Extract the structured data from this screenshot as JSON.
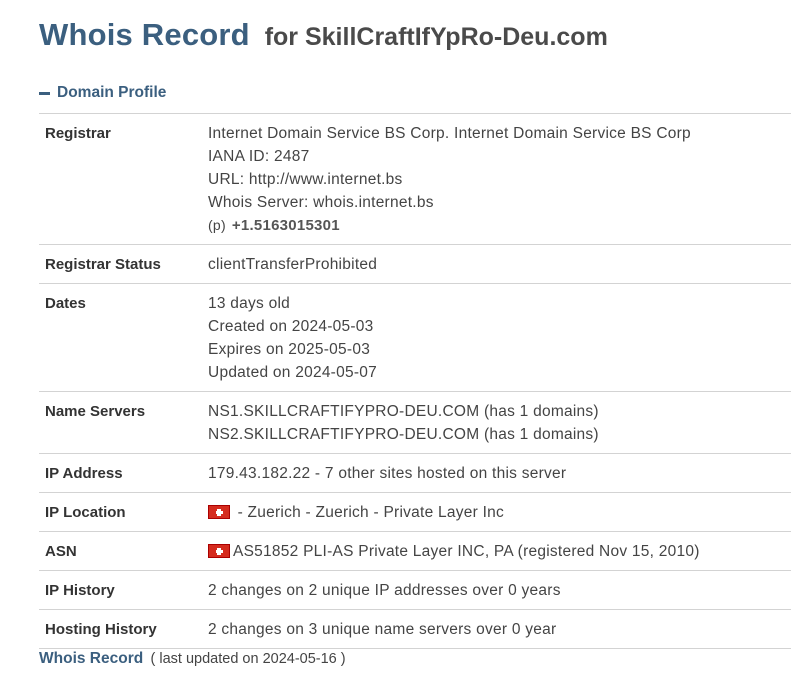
{
  "header": {
    "title": "Whois Record",
    "for_text": "for SkillCraftIfYpRo-Deu.com"
  },
  "section": {
    "title": "Domain Profile",
    "toggle_icon": "minus-icon"
  },
  "registrar": {
    "label": "Registrar",
    "name": "Internet Domain Service BS Corp. Internet Domain Service BS Corp",
    "iana": "IANA ID: 2487",
    "url": "URL: http://www.internet.bs",
    "whois_server": "Whois Server: whois.internet.bs",
    "phone_prefix": "(p)",
    "phone": "+1.5163015301"
  },
  "registrar_status": {
    "label": "Registrar Status",
    "value": "clientTransferProhibited"
  },
  "dates": {
    "label": "Dates",
    "age": "13 days old",
    "created": "Created on 2024-05-03",
    "expires": "Expires on 2025-05-03",
    "updated": "Updated on 2024-05-07"
  },
  "name_servers": {
    "label": "Name Servers",
    "ns1": "NS1.SKILLCRAFTIFYPRO-DEU.COM (has 1 domains)",
    "ns2": "NS2.SKILLCRAFTIFYPRO-DEU.COM (has 1 domains)"
  },
  "ip_address": {
    "label": "IP Address",
    "value": "179.43.182.22 - 7 other sites hosted on this server"
  },
  "ip_location": {
    "label": "IP Location",
    "flag_icon": "switzerland-flag-icon",
    "value": "- Zuerich - Zuerich - Private Layer Inc"
  },
  "asn": {
    "label": "ASN",
    "flag_icon": "switzerland-flag-icon",
    "value": "AS51852 PLI-AS Private Layer INC, PA (registered Nov 15, 2010)"
  },
  "ip_history": {
    "label": "IP History",
    "value": "2 changes on 2 unique IP addresses over 0 years"
  },
  "hosting_history": {
    "label": "Hosting History",
    "value": "2 changes on 3 unique name servers over 0 year"
  },
  "footer": {
    "title": "Whois Record",
    "updated": "( last updated on 2024-05-16 )"
  },
  "colors": {
    "heading_blue": "#3b5f7f",
    "divider": "#d3d3d3",
    "flag_red": "#d52b1e"
  }
}
